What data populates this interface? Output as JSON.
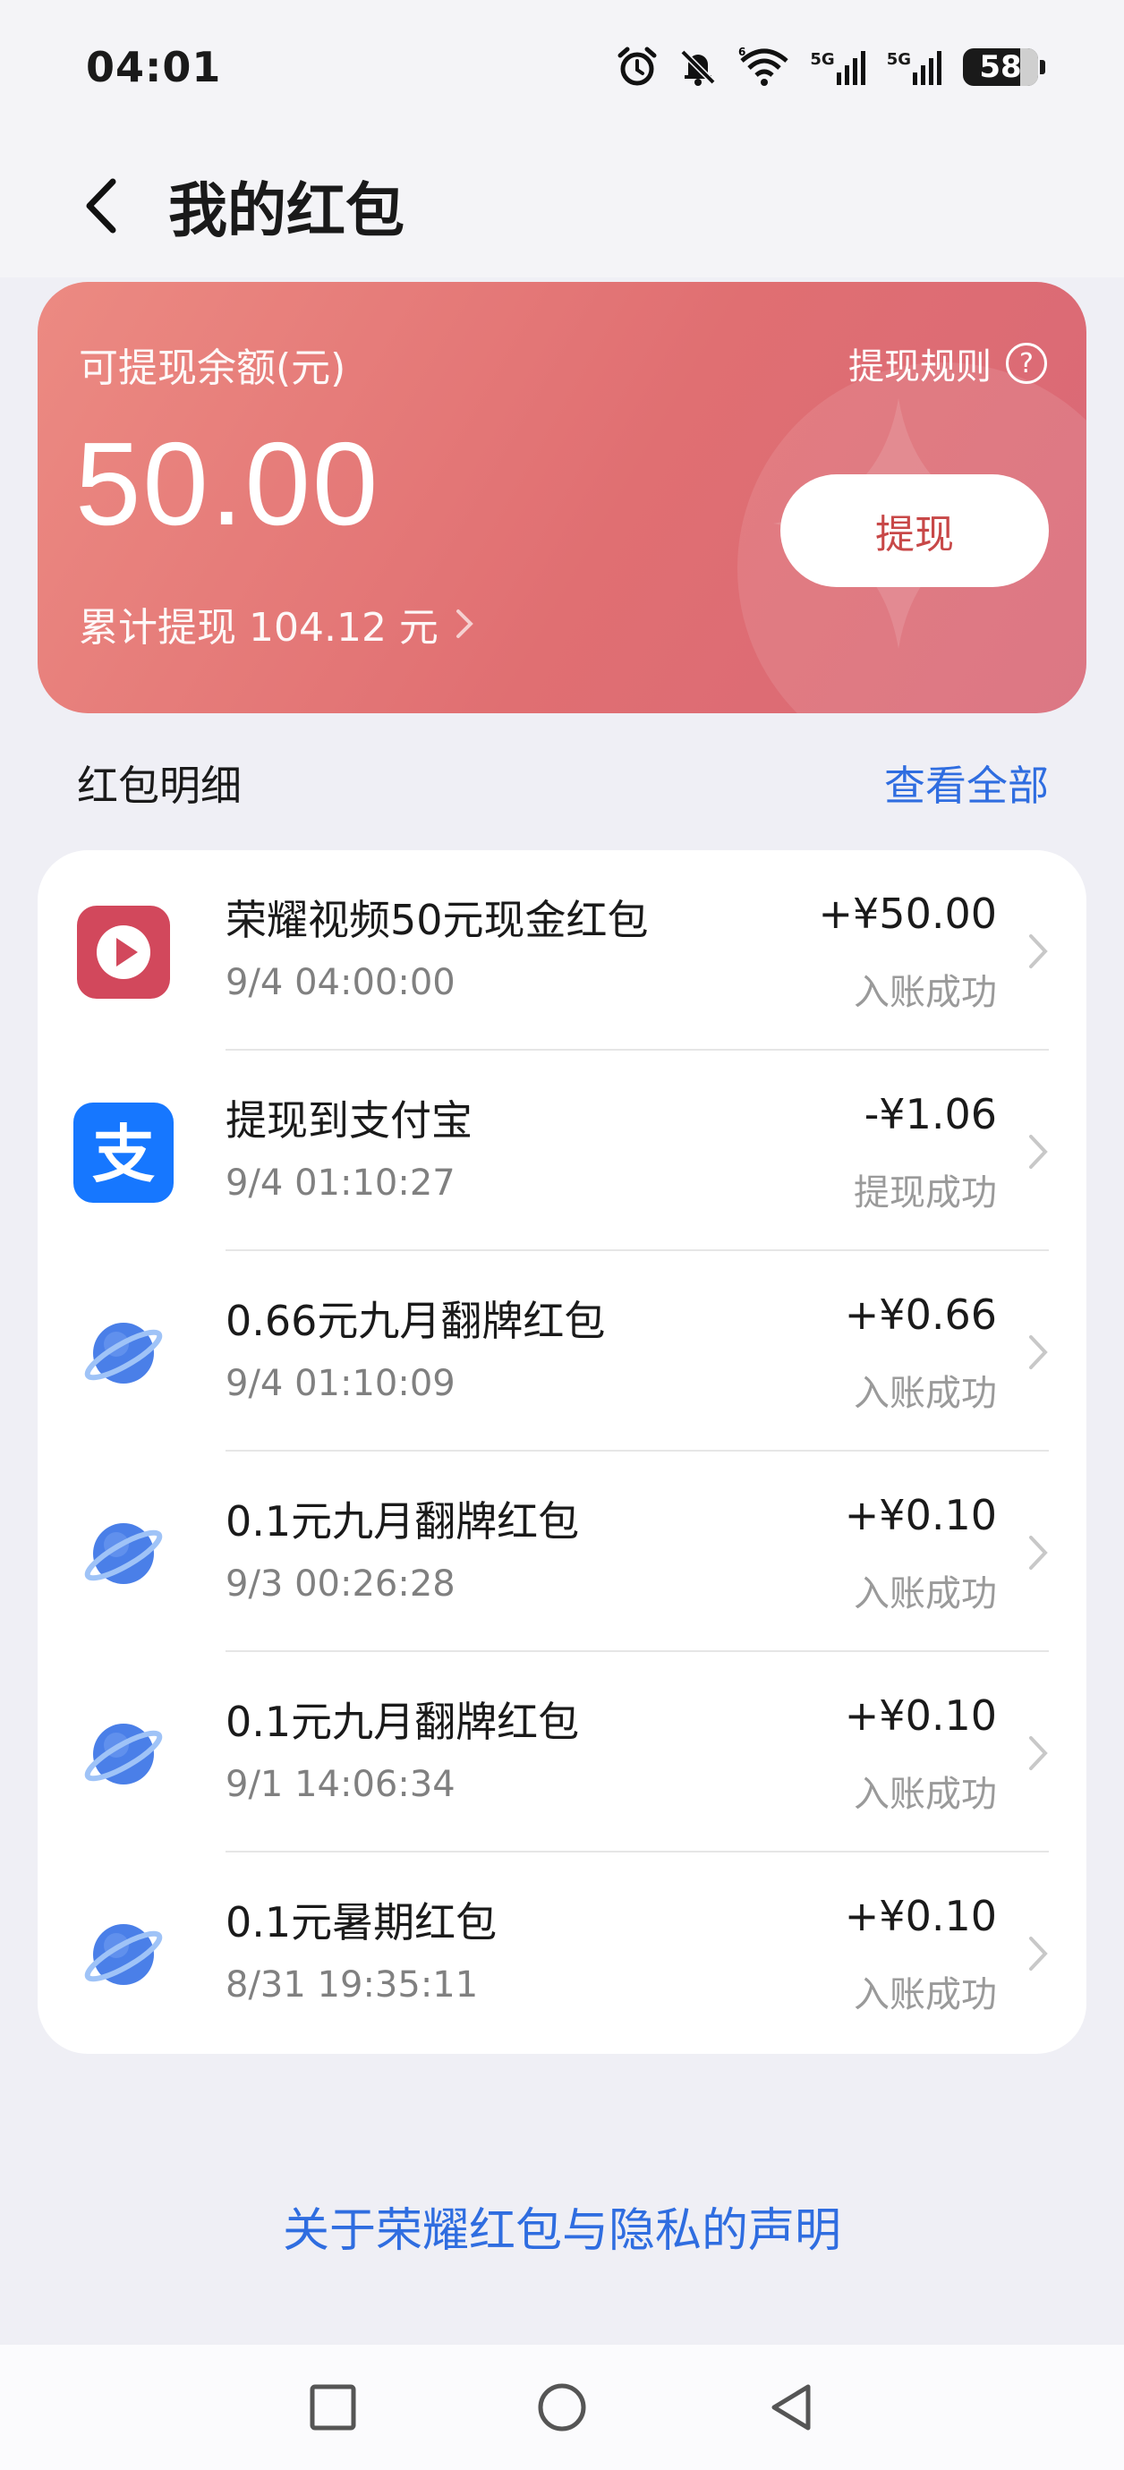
{
  "status": {
    "time": "04:01",
    "network_a": "5G",
    "network_b": "5G",
    "wifi_tag": "6",
    "battery": "58"
  },
  "header": {
    "title": "我的红包"
  },
  "balance": {
    "label": "可提现余额(元)",
    "amount": "50.00",
    "total": "累计提现 104.12 元",
    "rules_label": "提现规则",
    "withdraw_label": "提现"
  },
  "section": {
    "title": "红包明细",
    "view_all": "查看全部"
  },
  "items": [
    {
      "icon": "video-play-icon",
      "title": "荣耀视频50元现金红包",
      "time": "9/4 04:00:00",
      "amount": "+¥50.00",
      "status": "入账成功"
    },
    {
      "icon": "alipay-icon",
      "title": "提现到支付宝",
      "time": "9/4 01:10:27",
      "amount": "-¥1.06",
      "status": "提现成功"
    },
    {
      "icon": "planet-icon",
      "title": "0.66元九月翻牌红包",
      "time": "9/4 01:10:09",
      "amount": "+¥0.66",
      "status": "入账成功"
    },
    {
      "icon": "planet-icon",
      "title": "0.1元九月翻牌红包",
      "time": "9/3 00:26:28",
      "amount": "+¥0.10",
      "status": "入账成功"
    },
    {
      "icon": "planet-icon",
      "title": "0.1元九月翻牌红包",
      "time": "9/1 14:06:34",
      "amount": "+¥0.10",
      "status": "入账成功"
    },
    {
      "icon": "planet-icon",
      "title": "0.1元暑期红包",
      "time": "8/31 19:35:11",
      "amount": "+¥0.10",
      "status": "入账成功"
    }
  ],
  "footer": {
    "privacy": "关于荣耀红包与隐私的声明"
  },
  "colors": {
    "accent_blue": "#2f6de0",
    "card_red": "#e06f72",
    "withdraw_text": "#c84848"
  }
}
